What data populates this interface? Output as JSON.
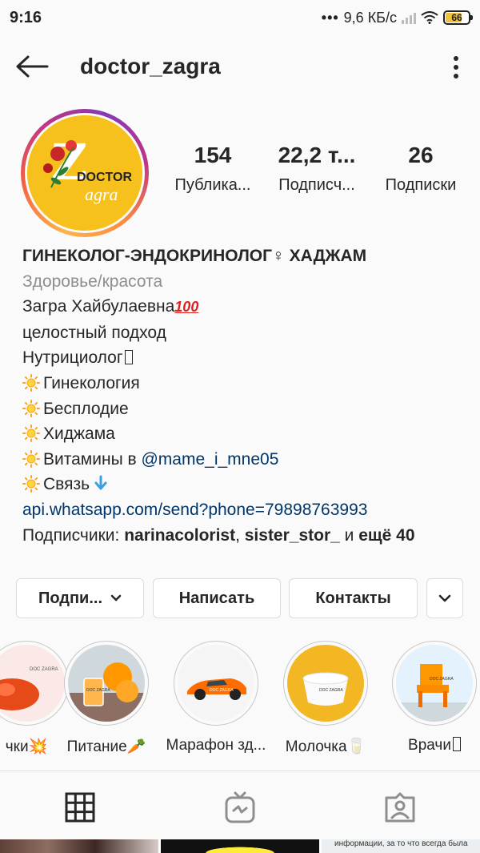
{
  "status_bar": {
    "time": "9:16",
    "dots": "•••",
    "network_speed": "9,6 КБ/с",
    "battery": "66"
  },
  "header": {
    "username": "doctor_zagra",
    "back_icon": "arrow-left-icon",
    "more_icon": "more-vertical-icon"
  },
  "profile": {
    "avatar_text_top": "DOCTOR",
    "avatar_text_bottom": "agra",
    "avatar_letter": "Z",
    "stats": [
      {
        "value": "154",
        "label": "Публика..."
      },
      {
        "value": "22,2 т...",
        "label": "Подписч..."
      },
      {
        "value": "26",
        "label": "Подписки"
      }
    ]
  },
  "bio": {
    "name": "ГИНЕКОЛОГ-ЭНДОКРИНОЛОГ♀ ХАДЖАМ",
    "category": "Здоровье/красота",
    "line1": "Загра Хайбулаевна",
    "line1_emoji": "100",
    "line2": "целостный подход",
    "line3": "Нутрициолог",
    "items": [
      "Гинекология",
      "Бесплодие",
      "Хиджама"
    ],
    "vitamins_prefix": "Витамины в ",
    "vitamins_mention": "@mame_i_mne05",
    "contact": "Связь",
    "link": "api.whatsapp.com/send?phone=79898763993",
    "followers_prefix": "Подписчики: ",
    "follower1": "narinacolorist",
    "comma": ", ",
    "follower2": "sister_stor_",
    "and": " и ",
    "more": "ещё 40"
  },
  "buttons": {
    "follow": "Подпи...",
    "message": "Написать",
    "contacts": "Контакты"
  },
  "highlights": [
    {
      "label": "чки💥"
    },
    {
      "label": "Питание🥕"
    },
    {
      "label": "Марафон зд..."
    },
    {
      "label": "Молочка🥛"
    },
    {
      "label": "Врачи"
    }
  ],
  "highlight_image_text": {
    "doc": "DOC ZAGRA"
  },
  "tabs": [
    {
      "icon": "grid-icon"
    },
    {
      "icon": "igtv-icon"
    },
    {
      "icon": "tagged-icon"
    }
  ],
  "grid_peek_text": "информации, за то что всегда была",
  "colors": {
    "link": "#003569",
    "category": "#8e8e8e",
    "avatar_bg": "#f6c11c",
    "mention_arrow": "#3aa0e0"
  }
}
